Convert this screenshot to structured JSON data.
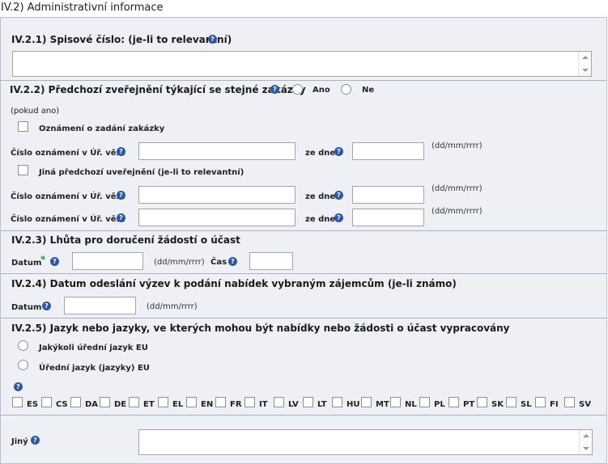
{
  "header": {
    "title": "IV.2) Administrativní informace"
  },
  "s1": {
    "title": "IV.2.1) Spisové číslo: (je-li to relevantní)",
    "value": ""
  },
  "s2": {
    "title": "IV.2.2) Předchozí zveřejnění týkající se stejné zakázky",
    "radio_yes": "Ano",
    "radio_no": "Ne",
    "if_yes": "(pokud ano)",
    "cb1_label": "Oznámení o zadání zakázky",
    "cb2_label": "Jiná předchozí uveřejnění (je-li to relevantní)",
    "number_label": "Číslo oznámení v Úř. věst",
    "date_label": "ze dne",
    "date_format": "(dd/mm/rrrr)"
  },
  "s3": {
    "title": "IV.2.3) Lhůta pro doručení žádostí o účast",
    "date_label": "Datum",
    "asterisk": "*",
    "date_format": "(dd/mm/rrrr)",
    "time_label": "Čas"
  },
  "s4": {
    "title": "IV.2.4) Datum odeslání výzev k podání nabídek vybraným zájemcům (je-li známo)",
    "date_label": "Datum",
    "date_format": "(dd/mm/rrrr)"
  },
  "s5": {
    "title": "IV.2.5) Jazyk nebo jazyky, ve kterých mohou být nabídky nebo žádosti o účast vypracovány",
    "radio1": "Jakýkoli úřední jazyk EU",
    "radio2": "Úřední jazyk (jazyky) EU",
    "languages": [
      "ES",
      "CS",
      "DA",
      "DE",
      "ET",
      "EL",
      "EN",
      "FR",
      "IT",
      "LV",
      "LT",
      "HU",
      "MT",
      "NL",
      "PL",
      "PT",
      "SK",
      "SL",
      "FI",
      "SV"
    ],
    "other_label": "Jiný"
  },
  "icons": {
    "help": "help-icon",
    "required": "required-asterisk"
  },
  "colors": {
    "panel": "#eef0f6",
    "help": "#2f57a0",
    "asterisk": "#2e9b2e"
  }
}
